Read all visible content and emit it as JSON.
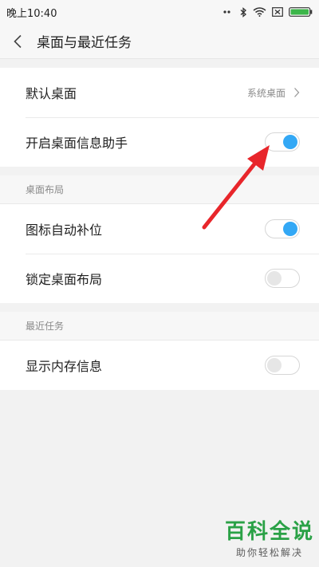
{
  "status_bar": {
    "time": "晚上10:40"
  },
  "header": {
    "title": "桌面与最近任务"
  },
  "sections": {
    "main": {
      "default_desktop": {
        "label": "默认桌面",
        "value": "系统桌面"
      },
      "desktop_assistant": {
        "label": "开启桌面信息助手",
        "enabled": true
      }
    },
    "layout": {
      "heading": "桌面布局",
      "auto_fill_icons": {
        "label": "图标自动补位",
        "enabled": true
      },
      "lock_layout": {
        "label": "锁定桌面布局",
        "enabled": false
      }
    },
    "recent": {
      "heading": "最近任务",
      "show_memory": {
        "label": "显示内存信息",
        "enabled": false
      }
    }
  },
  "watermark": {
    "main": "百科全说",
    "sub": "助你轻松解决"
  },
  "colors": {
    "toggle_on": "#33a8f5",
    "toggle_off": "#e6e6e6",
    "annotation_arrow": "#e8262b",
    "watermark_green": "#2aa146"
  }
}
